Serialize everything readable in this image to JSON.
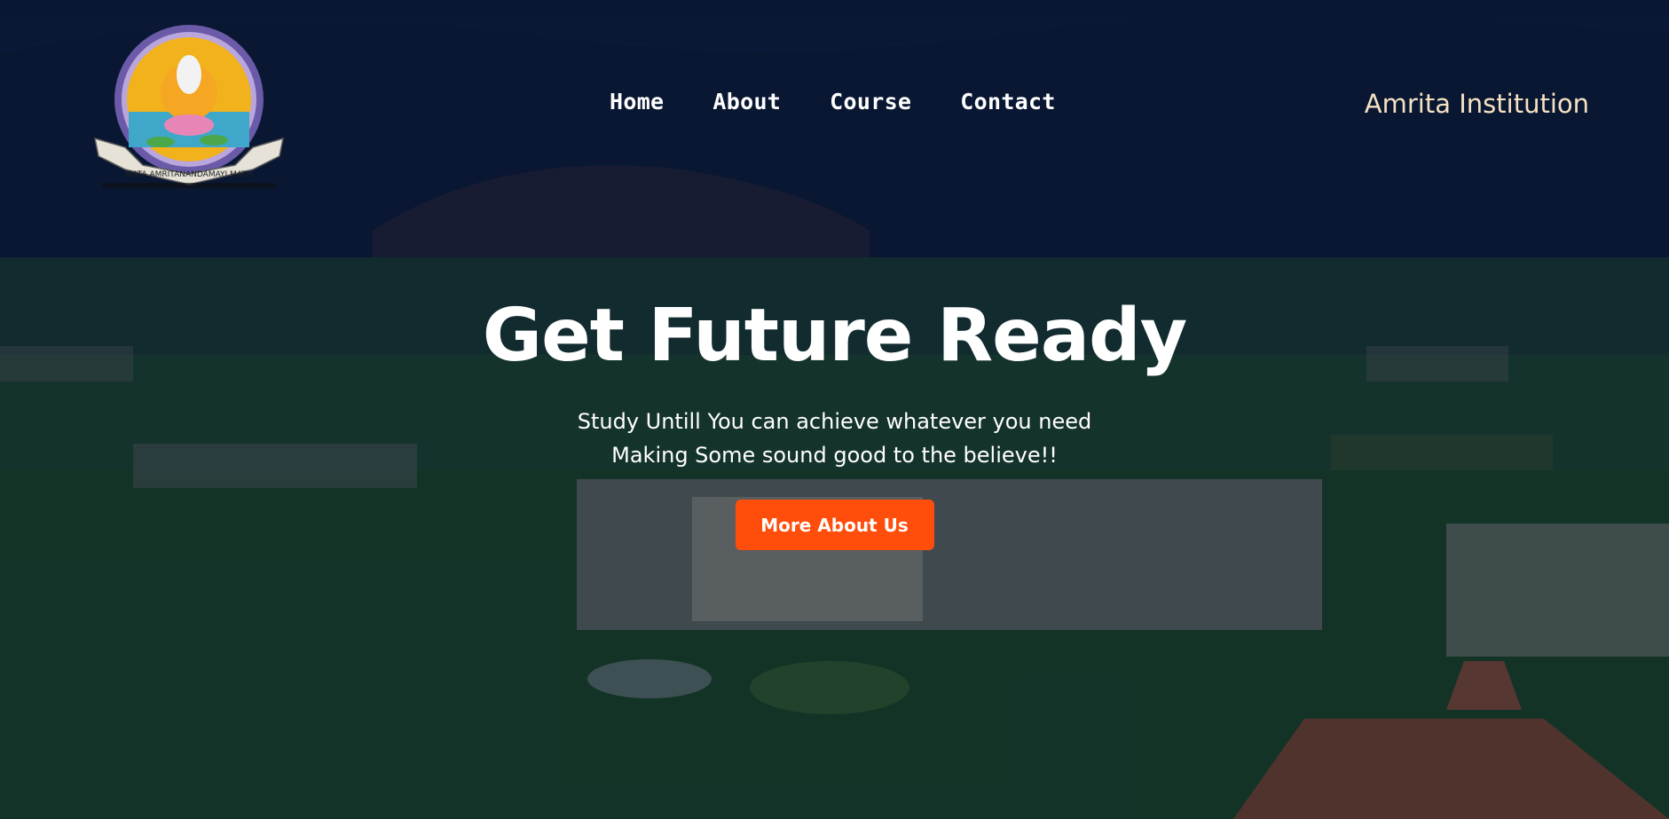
{
  "header": {
    "logo_alt": "Mata Amritanandamayi Math emblem",
    "logo_ribbon": "MATA AMRITANANDAMAYI MATH",
    "nav": [
      {
        "label": "Home"
      },
      {
        "label": "About"
      },
      {
        "label": "Course"
      },
      {
        "label": "Contact"
      }
    ],
    "brand": "Amrita Institution"
  },
  "hero": {
    "title": "Get Future Ready",
    "subtitle_line1": "Study Untill You can achieve whatever you need",
    "subtitle_line2": "Making Some sound good to the believe!!",
    "cta_label": "More About Us",
    "background": "aerial-campus-photo"
  },
  "colors": {
    "accent": "#ff4d0b",
    "brand_text": "#f6e1c2",
    "overlay": "#0a1430"
  }
}
